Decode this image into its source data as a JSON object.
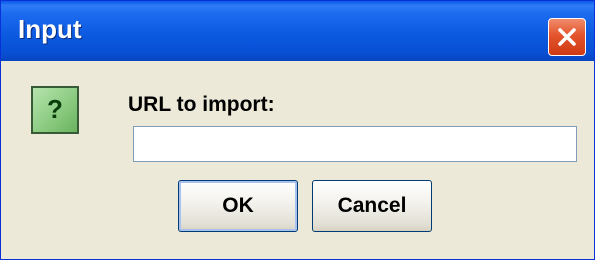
{
  "window": {
    "title": "Input"
  },
  "dialog": {
    "icon": "question-icon",
    "icon_glyph": "?",
    "prompt": "URL to import:",
    "input_value": "",
    "ok_label": "OK",
    "cancel_label": "Cancel"
  },
  "colors": {
    "titlebar": "#0b5ae0",
    "close_button": "#e4542c",
    "dialog_background": "#ece9d8",
    "icon_background": "#8ccc82"
  }
}
